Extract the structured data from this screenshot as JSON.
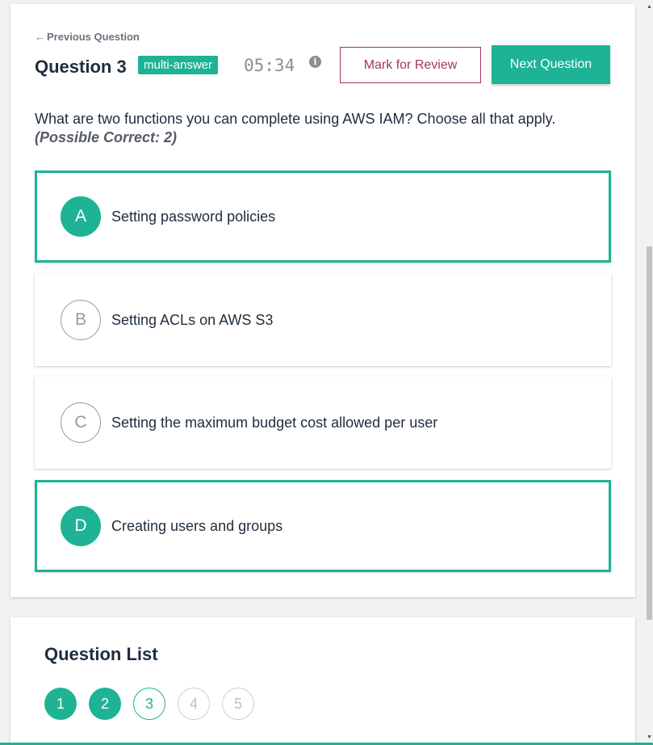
{
  "nav": {
    "prev_label": "Previous Question",
    "prev_arrow": "←"
  },
  "question": {
    "title": "Question 3",
    "tag": "multi-answer",
    "timer": "05:34",
    "info_glyph": "i",
    "text": "What are two functions you can complete using AWS IAM? Choose all that apply.",
    "subtext": "(Possible Correct: 2)"
  },
  "buttons": {
    "review": "Mark for Review",
    "next": "Next Question"
  },
  "options": [
    {
      "letter": "A",
      "text": "Setting password policies",
      "selected": true
    },
    {
      "letter": "B",
      "text": "Setting ACLs on AWS S3",
      "selected": false
    },
    {
      "letter": "C",
      "text": "Setting the maximum budget cost allowed per user",
      "selected": false
    },
    {
      "letter": "D",
      "text": "Creating users and groups",
      "selected": true
    }
  ],
  "question_list": {
    "title": "Question List",
    "items": [
      {
        "num": "1",
        "state": "done"
      },
      {
        "num": "2",
        "state": "done"
      },
      {
        "num": "3",
        "state": "current"
      },
      {
        "num": "4",
        "state": "todo"
      },
      {
        "num": "5",
        "state": "todo"
      }
    ]
  },
  "colors": {
    "accent": "#1db394",
    "review": "#a4365d",
    "muted": "#8a8f96"
  },
  "icons": {
    "prev": "arrow-left-icon",
    "info": "info-icon",
    "scroll_up": "triangle-up-icon",
    "scroll_down": "triangle-down-icon"
  }
}
